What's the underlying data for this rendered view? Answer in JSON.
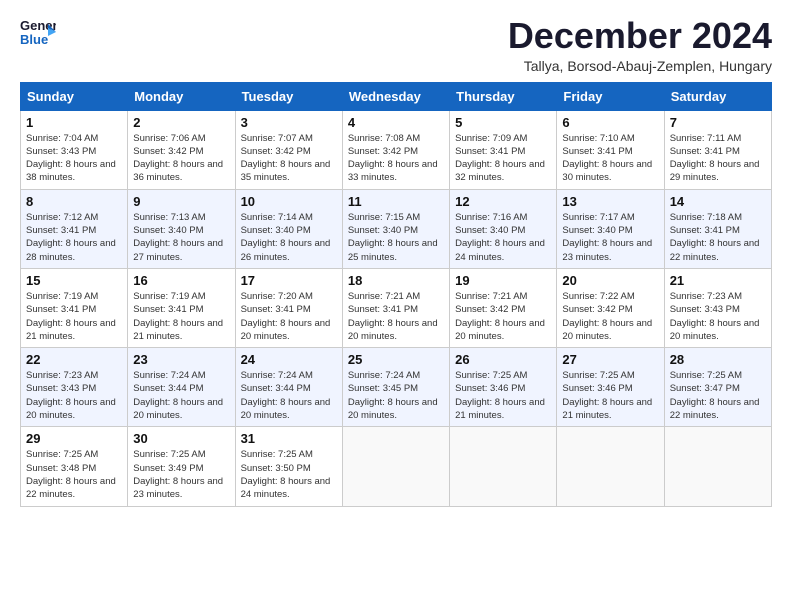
{
  "header": {
    "logo_line1": "General",
    "logo_line2": "Blue",
    "title": "December 2024",
    "subtitle": "Tallya, Borsod-Abauj-Zemplen, Hungary"
  },
  "days_of_week": [
    "Sunday",
    "Monday",
    "Tuesday",
    "Wednesday",
    "Thursday",
    "Friday",
    "Saturday"
  ],
  "weeks": [
    [
      {
        "day": 1,
        "sunrise": "7:04 AM",
        "sunset": "3:43 PM",
        "daylight": "8 hours and 38 minutes."
      },
      {
        "day": 2,
        "sunrise": "7:06 AM",
        "sunset": "3:42 PM",
        "daylight": "8 hours and 36 minutes."
      },
      {
        "day": 3,
        "sunrise": "7:07 AM",
        "sunset": "3:42 PM",
        "daylight": "8 hours and 35 minutes."
      },
      {
        "day": 4,
        "sunrise": "7:08 AM",
        "sunset": "3:42 PM",
        "daylight": "8 hours and 33 minutes."
      },
      {
        "day": 5,
        "sunrise": "7:09 AM",
        "sunset": "3:41 PM",
        "daylight": "8 hours and 32 minutes."
      },
      {
        "day": 6,
        "sunrise": "7:10 AM",
        "sunset": "3:41 PM",
        "daylight": "8 hours and 30 minutes."
      },
      {
        "day": 7,
        "sunrise": "7:11 AM",
        "sunset": "3:41 PM",
        "daylight": "8 hours and 29 minutes."
      }
    ],
    [
      {
        "day": 8,
        "sunrise": "7:12 AM",
        "sunset": "3:41 PM",
        "daylight": "8 hours and 28 minutes."
      },
      {
        "day": 9,
        "sunrise": "7:13 AM",
        "sunset": "3:40 PM",
        "daylight": "8 hours and 27 minutes."
      },
      {
        "day": 10,
        "sunrise": "7:14 AM",
        "sunset": "3:40 PM",
        "daylight": "8 hours and 26 minutes."
      },
      {
        "day": 11,
        "sunrise": "7:15 AM",
        "sunset": "3:40 PM",
        "daylight": "8 hours and 25 minutes."
      },
      {
        "day": 12,
        "sunrise": "7:16 AM",
        "sunset": "3:40 PM",
        "daylight": "8 hours and 24 minutes."
      },
      {
        "day": 13,
        "sunrise": "7:17 AM",
        "sunset": "3:40 PM",
        "daylight": "8 hours and 23 minutes."
      },
      {
        "day": 14,
        "sunrise": "7:18 AM",
        "sunset": "3:41 PM",
        "daylight": "8 hours and 22 minutes."
      }
    ],
    [
      {
        "day": 15,
        "sunrise": "7:19 AM",
        "sunset": "3:41 PM",
        "daylight": "8 hours and 21 minutes."
      },
      {
        "day": 16,
        "sunrise": "7:19 AM",
        "sunset": "3:41 PM",
        "daylight": "8 hours and 21 minutes."
      },
      {
        "day": 17,
        "sunrise": "7:20 AM",
        "sunset": "3:41 PM",
        "daylight": "8 hours and 20 minutes."
      },
      {
        "day": 18,
        "sunrise": "7:21 AM",
        "sunset": "3:41 PM",
        "daylight": "8 hours and 20 minutes."
      },
      {
        "day": 19,
        "sunrise": "7:21 AM",
        "sunset": "3:42 PM",
        "daylight": "8 hours and 20 minutes."
      },
      {
        "day": 20,
        "sunrise": "7:22 AM",
        "sunset": "3:42 PM",
        "daylight": "8 hours and 20 minutes."
      },
      {
        "day": 21,
        "sunrise": "7:23 AM",
        "sunset": "3:43 PM",
        "daylight": "8 hours and 20 minutes."
      }
    ],
    [
      {
        "day": 22,
        "sunrise": "7:23 AM",
        "sunset": "3:43 PM",
        "daylight": "8 hours and 20 minutes."
      },
      {
        "day": 23,
        "sunrise": "7:24 AM",
        "sunset": "3:44 PM",
        "daylight": "8 hours and 20 minutes."
      },
      {
        "day": 24,
        "sunrise": "7:24 AM",
        "sunset": "3:44 PM",
        "daylight": "8 hours and 20 minutes."
      },
      {
        "day": 25,
        "sunrise": "7:24 AM",
        "sunset": "3:45 PM",
        "daylight": "8 hours and 20 minutes."
      },
      {
        "day": 26,
        "sunrise": "7:25 AM",
        "sunset": "3:46 PM",
        "daylight": "8 hours and 21 minutes."
      },
      {
        "day": 27,
        "sunrise": "7:25 AM",
        "sunset": "3:46 PM",
        "daylight": "8 hours and 21 minutes."
      },
      {
        "day": 28,
        "sunrise": "7:25 AM",
        "sunset": "3:47 PM",
        "daylight": "8 hours and 22 minutes."
      }
    ],
    [
      {
        "day": 29,
        "sunrise": "7:25 AM",
        "sunset": "3:48 PM",
        "daylight": "8 hours and 22 minutes."
      },
      {
        "day": 30,
        "sunrise": "7:25 AM",
        "sunset": "3:49 PM",
        "daylight": "8 hours and 23 minutes."
      },
      {
        "day": 31,
        "sunrise": "7:25 AM",
        "sunset": "3:50 PM",
        "daylight": "8 hours and 24 minutes."
      },
      null,
      null,
      null,
      null
    ]
  ]
}
